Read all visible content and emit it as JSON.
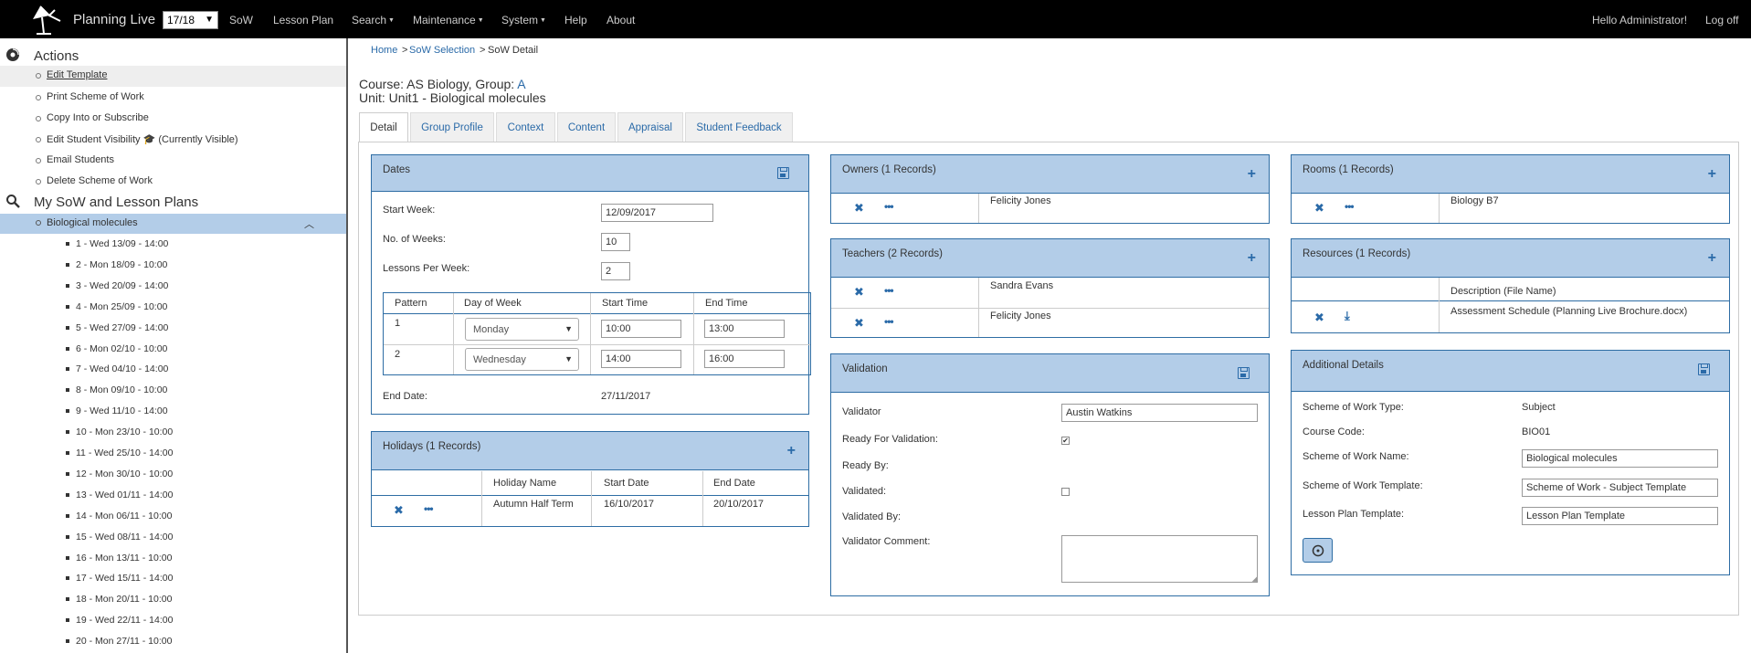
{
  "navbar": {
    "brand": "Planning Live",
    "year": "17/18",
    "items": {
      "sow": "SoW",
      "lesson_plan": "Lesson Plan",
      "search": "Search",
      "maintenance": "Maintenance",
      "system": "System",
      "help": "Help",
      "about": "About"
    },
    "greeting": "Hello Administrator!",
    "logoff": "Log off"
  },
  "sidebar": {
    "actions_title": "Actions",
    "actions": [
      "Edit Template",
      "Print Scheme of Work",
      "Copy Into or Subscribe",
      "Edit Student Visibility",
      "Email Students",
      "Delete Scheme of Work"
    ],
    "visibility_status": "(Currently Visible)",
    "my_title": "My SoW and Lesson Plans",
    "sow_item": "Biological molecules",
    "lessons": [
      "1 - Wed 13/09 - 14:00",
      "2 - Mon 18/09 - 10:00",
      "3 - Wed 20/09 - 14:00",
      "4 - Mon 25/09 - 10:00",
      "5 - Wed 27/09 - 14:00",
      "6 - Mon 02/10 - 10:00",
      "7 - Wed 04/10 - 14:00",
      "8 - Mon 09/10 - 10:00",
      "9 - Wed 11/10 - 14:00",
      "10 - Mon 23/10 - 10:00",
      "11 - Wed 25/10 - 14:00",
      "12 - Mon 30/10 - 10:00",
      "13 - Wed 01/11 - 14:00",
      "14 - Mon 06/11 - 10:00",
      "15 - Wed 08/11 - 14:00",
      "16 - Mon 13/11 - 10:00",
      "17 - Wed 15/11 - 14:00",
      "18 - Mon 20/11 - 10:00",
      "19 - Wed 22/11 - 14:00",
      "20 - Mon 27/11 - 10:00"
    ]
  },
  "breadcrumb": {
    "home": "Home",
    "sep": ">",
    "selection": "SoW Selection",
    "current": "SoW Detail"
  },
  "course": {
    "course_prefix": "Course: AS Biology, Group:",
    "group": "A",
    "unit": "Unit: Unit1 - Biological molecules"
  },
  "tabs": [
    "Detail",
    "Group Profile",
    "Context",
    "Content",
    "Appraisal",
    "Student Feedback"
  ],
  "dates": {
    "title": "Dates",
    "start_week_label": "Start Week:",
    "start_week": "12/09/2017",
    "weeks_label": "No. of Weeks:",
    "weeks": "10",
    "lessons_label": "Lessons Per Week:",
    "lessons": "2",
    "columns": [
      "Pattern",
      "Day of Week",
      "Start Time",
      "End Time"
    ],
    "rows": [
      {
        "pattern": "1",
        "day": "Monday",
        "start": "10:00",
        "end": "13:00"
      },
      {
        "pattern": "2",
        "day": "Wednesday",
        "start": "14:00",
        "end": "16:00"
      }
    ],
    "end_date_label": "End Date:",
    "end_date": "27/11/2017"
  },
  "holidays": {
    "title": "Holidays (1 Records)",
    "columns": [
      "Holiday Name",
      "Start Date",
      "End Date"
    ],
    "rows": [
      {
        "name": "Autumn Half Term",
        "start": "16/10/2017",
        "end": "20/10/2017"
      }
    ]
  },
  "owners": {
    "title": "Owners (1 Records)",
    "rows": [
      "Felicity Jones"
    ]
  },
  "teachers": {
    "title": "Teachers (2 Records)",
    "rows": [
      "Sandra Evans",
      "Felicity Jones"
    ]
  },
  "validation": {
    "title": "Validation",
    "validator_label": "Validator",
    "validator": "Austin Watkins",
    "ready_label": "Ready For Validation:",
    "ready_by_label": "Ready By:",
    "validated_label": "Validated:",
    "validated_by_label": "Validated By:",
    "comment_label": "Validator Comment:"
  },
  "rooms": {
    "title": "Rooms (1 Records)",
    "rows": [
      "Biology B7"
    ]
  },
  "resources": {
    "title": "Resources (1 Records)",
    "column": "Description (File Name)",
    "rows": [
      "Assessment Schedule (Planning Live Brochure.docx)"
    ]
  },
  "additional": {
    "title": "Additional Details",
    "type_label": "Scheme of Work Type:",
    "type": "Subject",
    "code_label": "Course Code:",
    "code": "BIO01",
    "name_label": "Scheme of Work Name:",
    "name": "Biological molecules",
    "template_label": "Scheme of Work Template:",
    "template": "Scheme of Work - Subject Template",
    "lp_template_label": "Lesson Plan Template:",
    "lp_template": "Lesson Plan Template"
  },
  "colors": {
    "accent": "#2a6aa8",
    "panel_header": "#b3cde8",
    "navbar": "#000000"
  }
}
